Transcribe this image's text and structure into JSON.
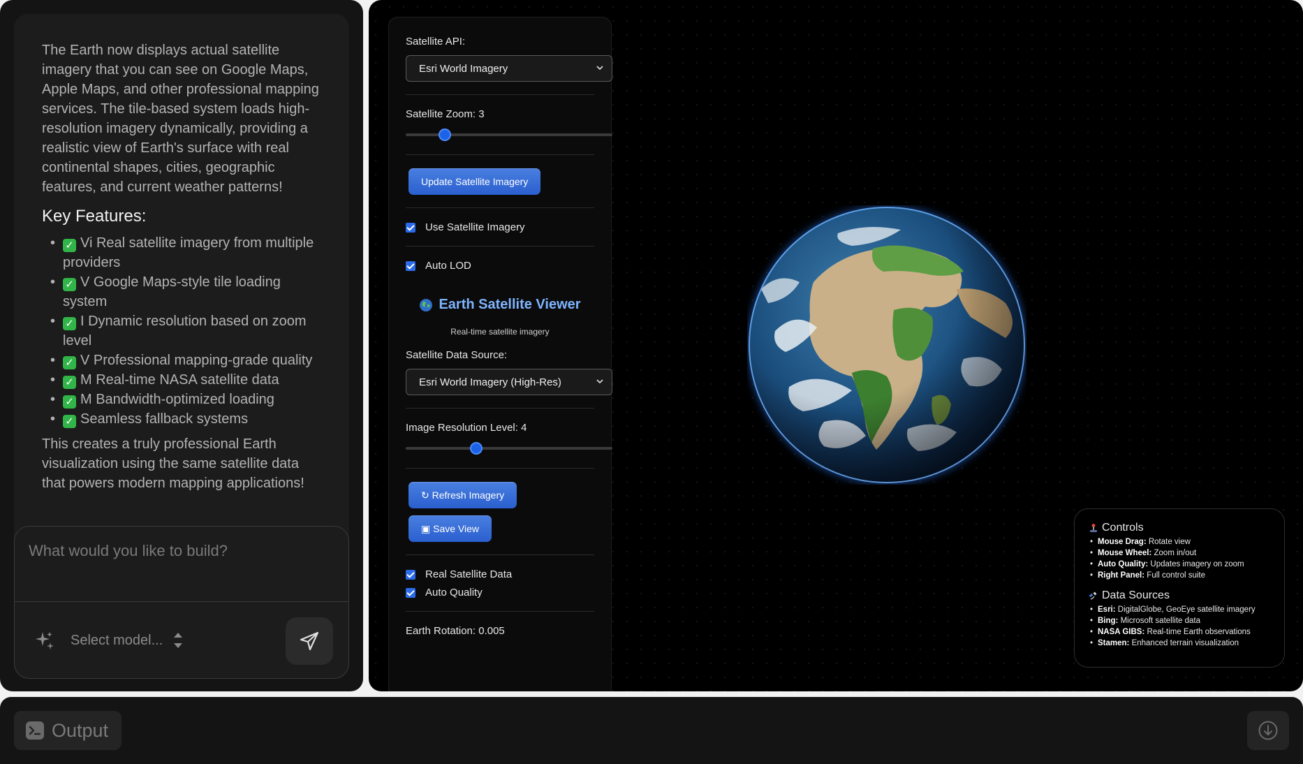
{
  "chat": {
    "intro": "The Earth now displays actual satellite imagery that you can see on Google Maps, Apple Maps, and other professional mapping services. The tile-based system loads high-resolution imagery dynamically, providing a realistic view of Earth's surface with real continental shapes, cities, geographic features, and current weather patterns!",
    "features_heading": "Key Features:",
    "features": [
      {
        "check": "✓",
        "text": "Vi Real satellite imagery from multiple providers"
      },
      {
        "check": "✓",
        "text": "V Google Maps-style tile loading system"
      },
      {
        "check": "✓",
        "text": "I Dynamic resolution based on zoom level"
      },
      {
        "check": "✓",
        "text": "V Professional mapping-grade quality"
      },
      {
        "check": "✓",
        "text": "M Real-time NASA satellite data"
      },
      {
        "check": "✓",
        "text": "M Bandwidth-optimized loading"
      },
      {
        "check": "✓",
        "text": "Seamless fallback systems"
      }
    ],
    "outro": "This creates a truly professional Earth visualization using the same satellite data that powers modern mapping applications!",
    "composer_placeholder": "What would you like to build?",
    "model_select_label": "Select model..."
  },
  "controls": {
    "satellite_api_label": "Satellite API:",
    "satellite_api_value": "Esri World Imagery",
    "satellite_zoom_label": "Satellite Zoom: 3",
    "satellite_zoom_fraction": 0.19,
    "update_button": "Update Satellite Imagery",
    "use_satellite_label": "Use Satellite Imagery",
    "auto_lod_label": "Auto LOD",
    "viewer_title": "Earth Satellite Viewer",
    "viewer_subtitle": "Real-time satellite imagery",
    "data_source_label": "Satellite Data Source:",
    "data_source_value": "Esri World Imagery (High-Res)",
    "resolution_label": "Image Resolution Level: 4",
    "resolution_fraction": 0.34,
    "refresh_button": "Refresh Imagery",
    "save_button": "Save View",
    "real_data_label": "Real Satellite Data",
    "auto_quality_label": "Auto Quality",
    "rotation_label": "Earth Rotation: 0.005"
  },
  "info": {
    "controls_heading": "Controls",
    "controls_items": [
      {
        "key": "Mouse Drag:",
        "text": "Rotate view"
      },
      {
        "key": "Mouse Wheel:",
        "text": "Zoom in/out"
      },
      {
        "key": "Auto Quality:",
        "text": "Updates imagery on zoom"
      },
      {
        "key": "Right Panel:",
        "text": "Full control suite"
      }
    ],
    "sources_heading": "Data Sources",
    "sources_items": [
      {
        "key": "Esri:",
        "text": "DigitalGlobe, GeoEye satellite imagery"
      },
      {
        "key": "Bing:",
        "text": "Microsoft satellite data"
      },
      {
        "key": "NASA GIBS:",
        "text": "Real-time Earth observations"
      },
      {
        "key": "Stamen:",
        "text": "Enhanced terrain visualization"
      }
    ]
  },
  "bottom": {
    "output_tab_label": "Output"
  },
  "icons": {
    "sparkle": "sparkle-icon",
    "send": "send-icon",
    "terminal": "terminal-icon",
    "download": "download-icon"
  },
  "colors": {
    "accent_blue": "#2b6be8",
    "check_green": "#32b548",
    "title_blue": "#7eb4ff"
  }
}
